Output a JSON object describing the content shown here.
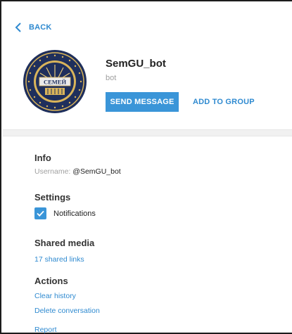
{
  "back_label": "BACK",
  "profile": {
    "name": "SemGU_bot",
    "subtitle": "bot",
    "avatar_text": "СЕМЕЙ"
  },
  "actions_row": {
    "send_message": "SEND MESSAGE",
    "add_to_group": "ADD TO GROUP"
  },
  "info": {
    "title": "Info",
    "username_label": "Username:",
    "username_value": "@SemGU_bot"
  },
  "settings": {
    "title": "Settings",
    "notifications_label": "Notifications",
    "notifications_checked": true
  },
  "shared_media": {
    "title": "Shared media",
    "links": "17 shared links"
  },
  "actions": {
    "title": "Actions",
    "clear_history": "Clear history",
    "delete_conversation": "Delete conversation",
    "report": "Report"
  },
  "colors": {
    "accent": "#3a95d8",
    "link": "#2f8ad0",
    "muted": "#a0a0a0",
    "band": "#f1f1f1"
  }
}
